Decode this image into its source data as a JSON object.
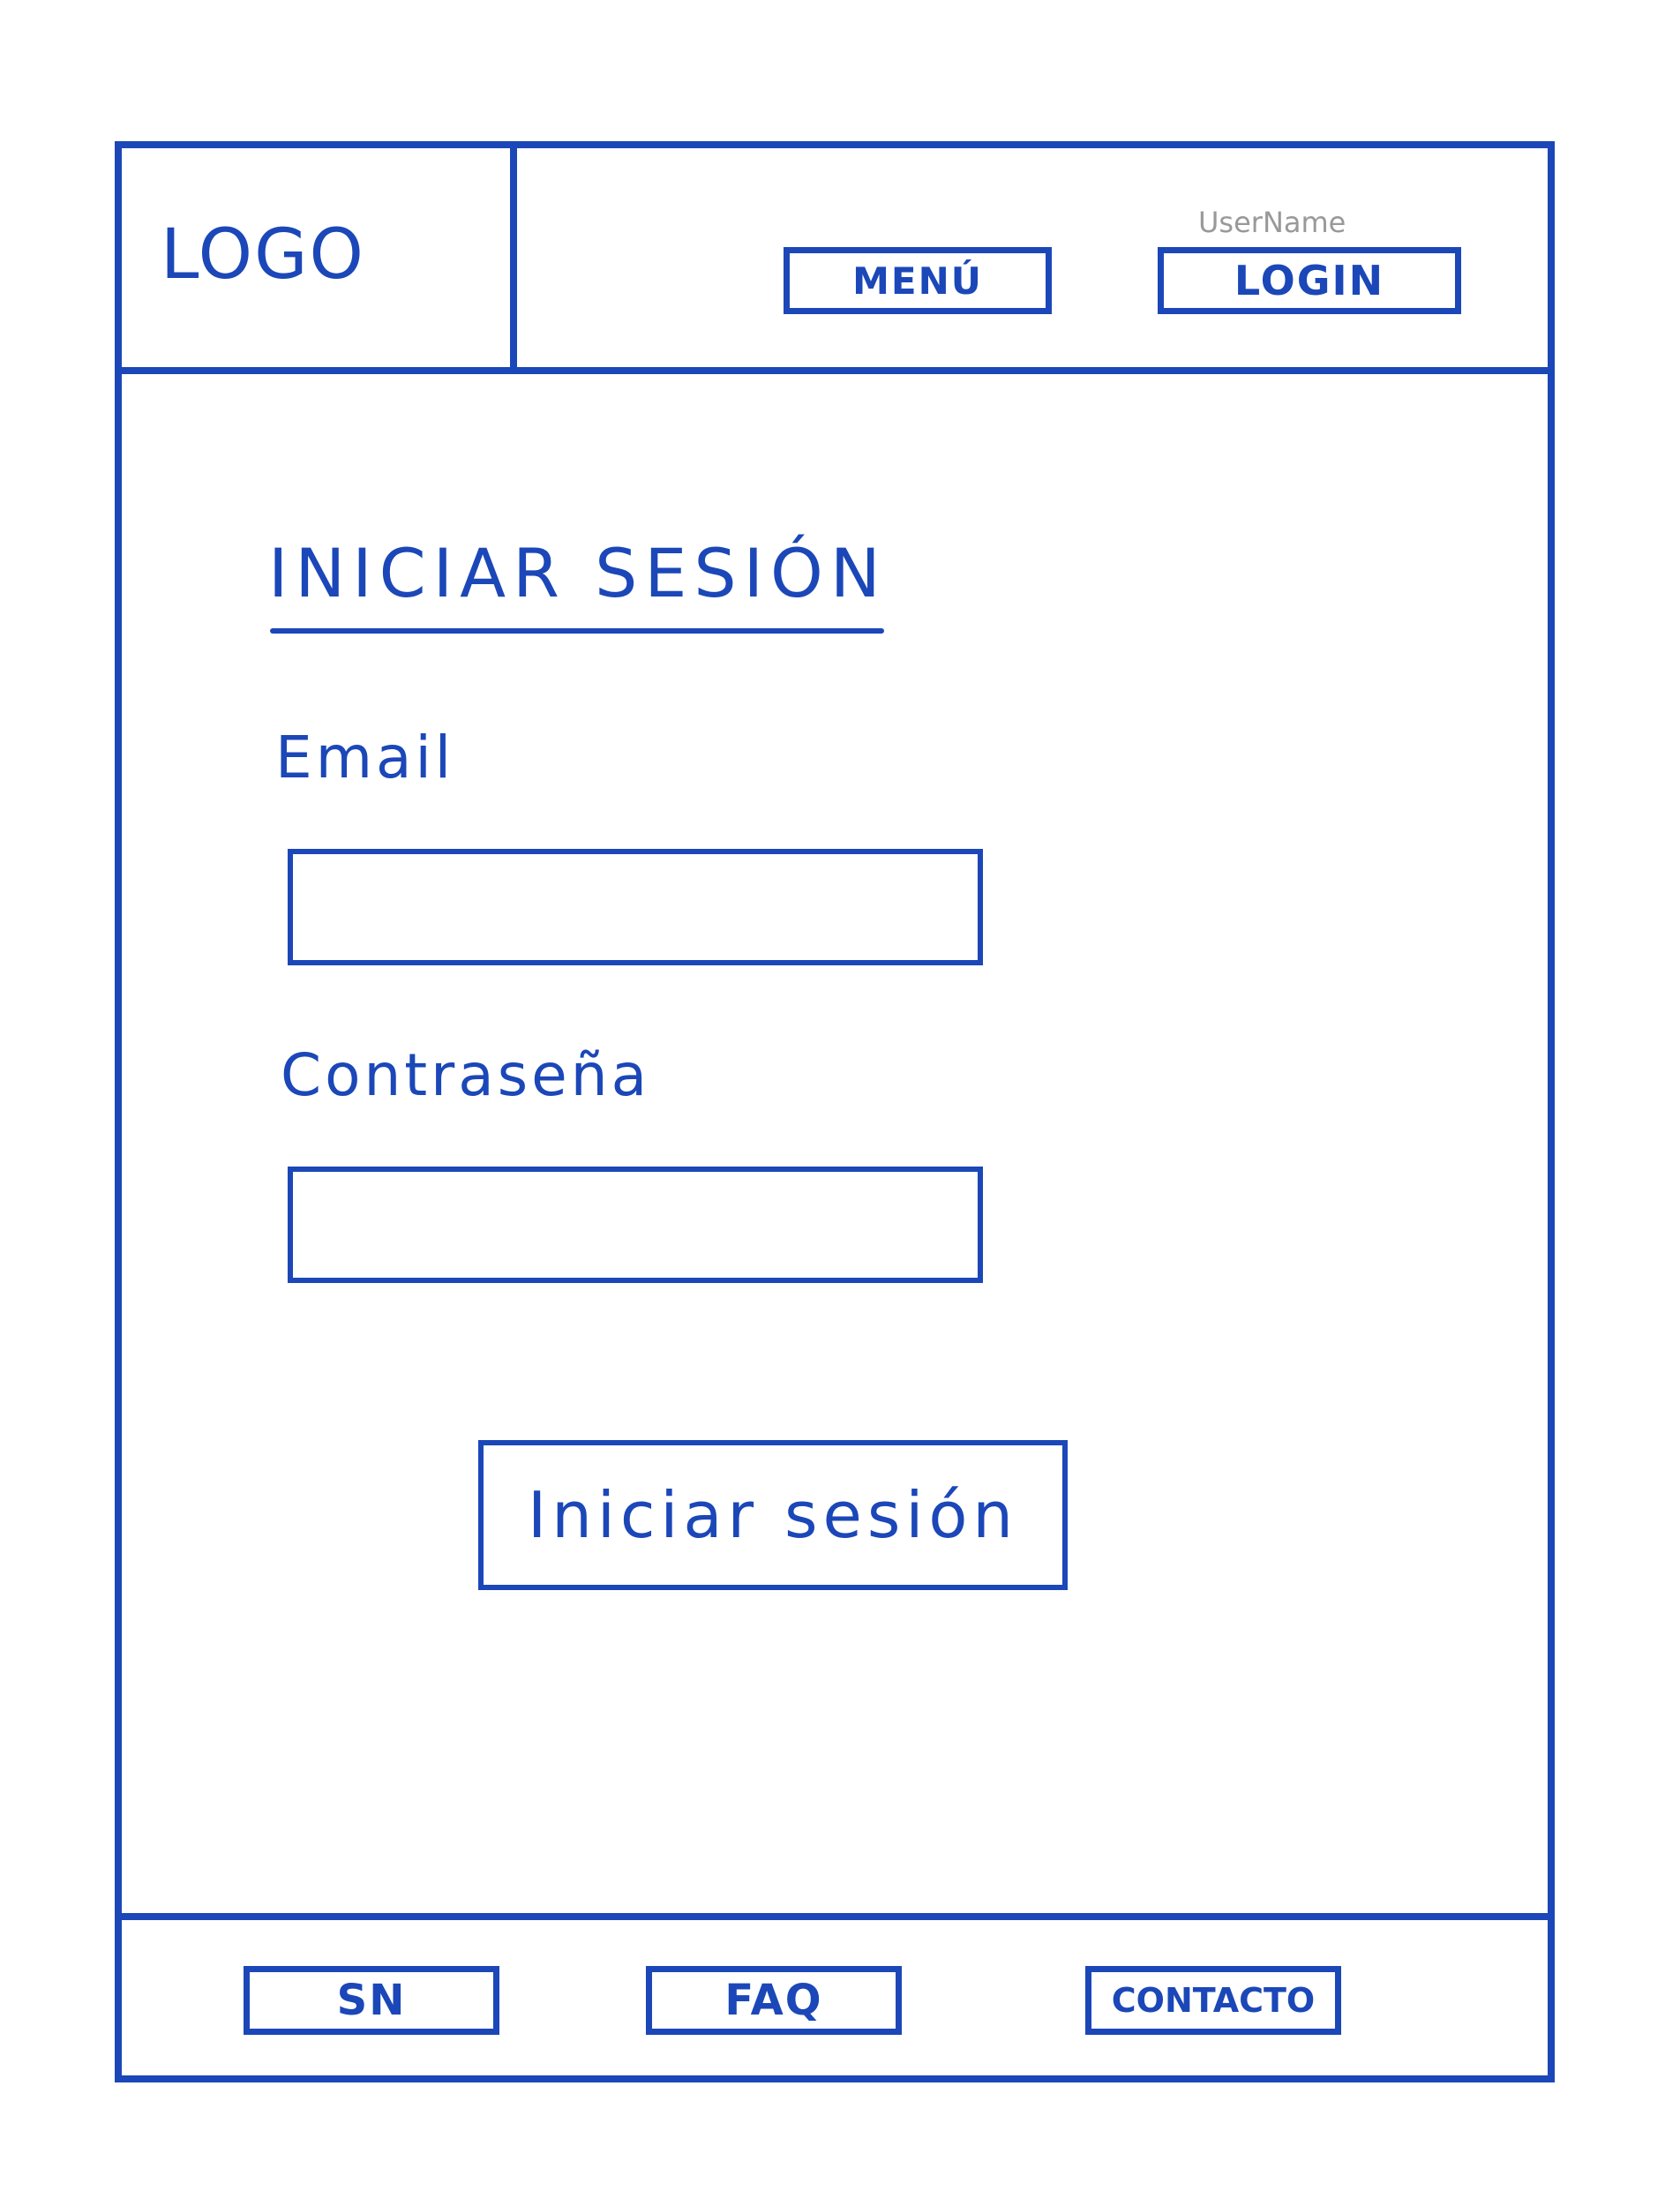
{
  "header": {
    "logo_text": "LOGO",
    "menu_label": "MENÚ",
    "username_text": "UserName",
    "login_label": "LOGIN"
  },
  "main": {
    "heading": "INICIAR SESIÓN",
    "email_label": "Email",
    "email_value": "",
    "password_label": "Contraseña",
    "password_value": "",
    "submit_label": "Iniciar sesión"
  },
  "footer": {
    "items": [
      {
        "label": "SN"
      },
      {
        "label": "FAQ"
      },
      {
        "label": "CONTACTO"
      }
    ]
  },
  "colors": {
    "ink": "#1b47b8",
    "username_gray": "#999999"
  }
}
